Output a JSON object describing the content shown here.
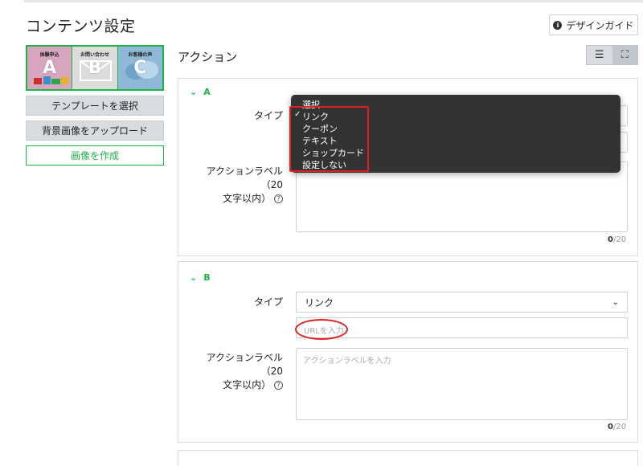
{
  "header": {
    "title": "コンテンツ設定",
    "guide_button": "デザインガイド",
    "guide_icon": "i"
  },
  "left": {
    "tiles": [
      {
        "caption": "体験申込",
        "letter": "A"
      },
      {
        "caption": "お問い合わせ",
        "letter": "B"
      },
      {
        "caption": "お客様の声",
        "letter": "C"
      }
    ],
    "select_template": "テンプレートを選択",
    "upload_background": "背景画像をアップロード",
    "create_image": "画像を作成"
  },
  "actions": {
    "title": "アクション",
    "view_list_icon": "☰",
    "view_full_icon": "⛶",
    "a": {
      "head": "A",
      "type_label": "タイプ",
      "action_label": "アクションラベル（20文字以内）",
      "action_label_line1": "アクションラベル（20",
      "action_label_line2": "文字以内）",
      "count_current": "0",
      "count_total": "/20"
    },
    "b": {
      "head": "B",
      "type_label": "タイプ",
      "type_value": "リンク",
      "url_placeholder": "URLを入力",
      "action_label_line1": "アクションラベル（20",
      "action_label_line2": "文字以内）",
      "action_placeholder": "アクションラベルを入力",
      "count_current": "0",
      "count_total": "/20"
    }
  },
  "dropdown": {
    "options": [
      "選択",
      "リンク",
      "クーポン",
      "テキスト",
      "ショップカード",
      "設定しない"
    ],
    "selected": "リンク",
    "check": "✓"
  },
  "colors": {
    "accent_green": "#1db446",
    "highlight_red": "#e02020",
    "dropdown_bg": "#333333"
  }
}
